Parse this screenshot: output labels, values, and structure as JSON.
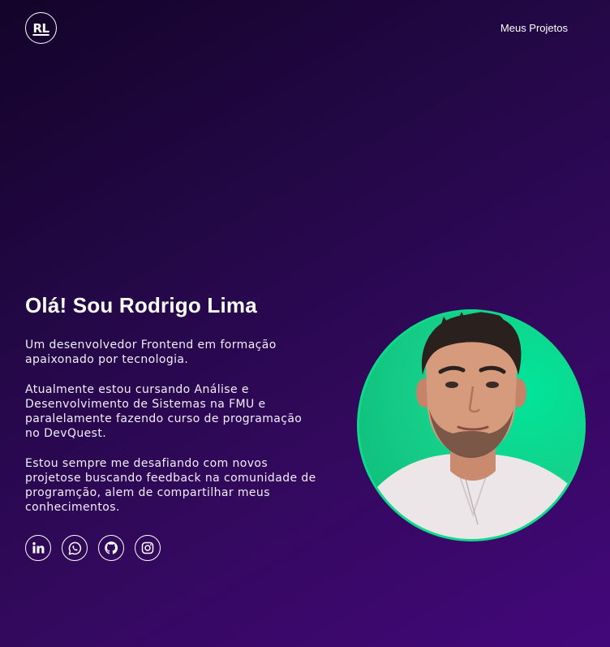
{
  "header": {
    "logo_text": "RL",
    "nav_link": "Meus Projetos"
  },
  "hero": {
    "title": "Olá! Sou Rodrigo Lima",
    "paragraphs": [
      "Um desenvolvedor Frontend em formação apaixonado por tecnologia.",
      "Atualmente estou cursando Análise e Desenvolvimento de Sistemas na FMU e paralelamente fazendo curso de programação no DevQuest.",
      "Estou sempre me desafiando com novos projetose buscando feedback na comunidade de programção, alem de compartilhar meus conhecimentos."
    ]
  },
  "socials": [
    {
      "icon": "linkedin-icon"
    },
    {
      "icon": "whatsapp-icon"
    },
    {
      "icon": "github-icon"
    },
    {
      "icon": "instagram-icon"
    }
  ],
  "colors": {
    "background_start": "#14032a",
    "background_end": "#43077a",
    "avatar_ring": "#10d98b",
    "avatar_bg": "#00e59a"
  }
}
